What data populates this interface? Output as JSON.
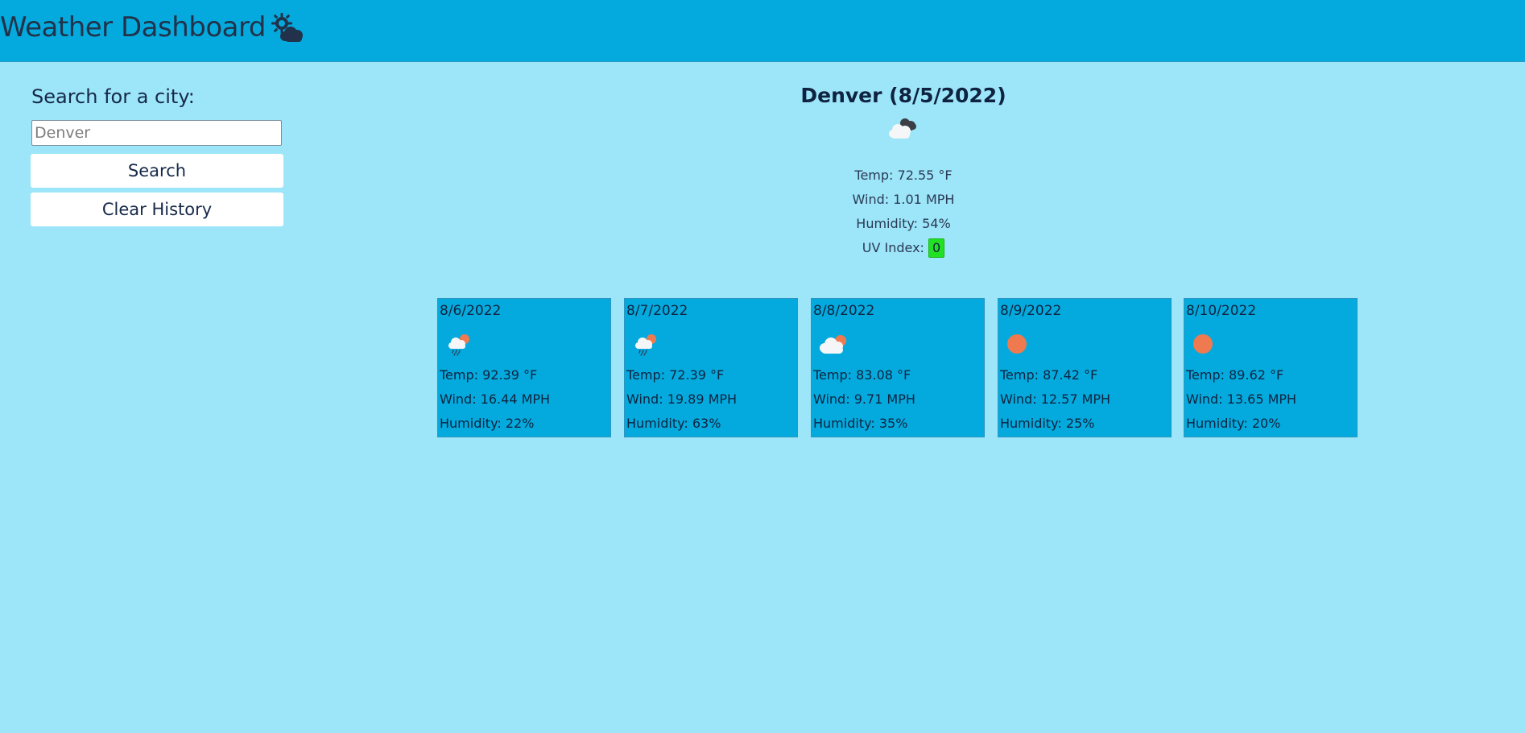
{
  "header": {
    "title": "Weather Dashboard",
    "icon": "sun-cloud-icon"
  },
  "sidebar": {
    "label": "Search for a city:",
    "input_placeholder": "Denver",
    "input_value": "",
    "search_label": "Search",
    "clear_label": "Clear History"
  },
  "current": {
    "title": "Denver (8/5/2022)",
    "icon": "broken-clouds-icon",
    "temp": "Temp: 72.55 °F",
    "wind": "Wind: 1.01 MPH",
    "humidity": "Humidity: 54%",
    "uv_label": "UV Index:",
    "uv_value": "0",
    "uv_color": "#22e022"
  },
  "forecast": [
    {
      "date": "8/6/2022",
      "icon": "rain-sun-icon",
      "temp": "Temp: 92.39 °F",
      "wind": "Wind: 16.44 MPH",
      "humidity": "Humidity: 22%"
    },
    {
      "date": "8/7/2022",
      "icon": "rain-sun-icon",
      "temp": "Temp: 72.39 °F",
      "wind": "Wind: 19.89 MPH",
      "humidity": "Humidity: 63%"
    },
    {
      "date": "8/8/2022",
      "icon": "cloud-sun-icon",
      "temp": "Temp: 83.08 °F",
      "wind": "Wind: 9.71 MPH",
      "humidity": "Humidity: 35%"
    },
    {
      "date": "8/9/2022",
      "icon": "sun-icon",
      "temp": "Temp: 87.42 °F",
      "wind": "Wind: 12.57 MPH",
      "humidity": "Humidity: 25%"
    },
    {
      "date": "8/10/2022",
      "icon": "sun-icon",
      "temp": "Temp: 89.62 °F",
      "wind": "Wind: 13.65 MPH",
      "humidity": "Humidity: 20%"
    }
  ],
  "colors": {
    "page_background": "#9de5f9",
    "header_background": "#04aadd",
    "card_background": "#04aadd",
    "sun": "#ef7a50"
  }
}
